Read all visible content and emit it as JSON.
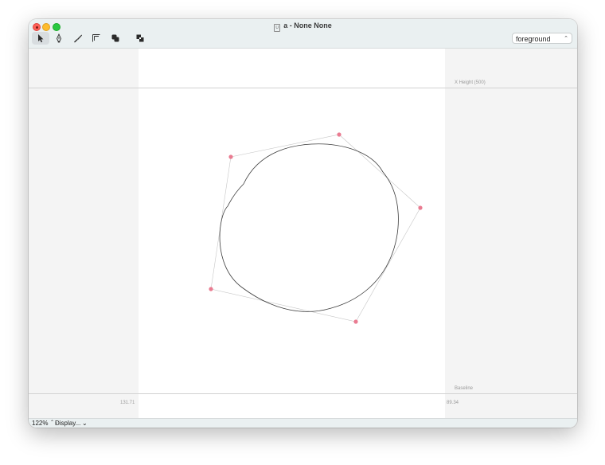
{
  "window": {
    "title": "a - None None",
    "doc_icon_text": "U"
  },
  "toolbar": {
    "tools": [
      "pointer-tool",
      "pen-tool",
      "knife-tool",
      "metrics-tool",
      "overlap-tool",
      "subtract-tool"
    ],
    "layer_value": "foreground"
  },
  "metrics": {
    "x_height_label": "X Height (500)",
    "baseline_label": "Baseline",
    "left_sidebearing": "131.71",
    "right_sidebearing": "89.34"
  },
  "statusbar": {
    "zoom": "122%",
    "display_label": "Display...",
    "display_arrows": "⌃⌄",
    "chevron": "⌄"
  },
  "colors": {
    "point_color": "#ea7b91",
    "outline_color": "#3c3c3c",
    "handle_line_color": "#c6c6c6"
  },
  "glyph": {
    "on_curve_points": [],
    "off_curve_points_count": 5
  }
}
